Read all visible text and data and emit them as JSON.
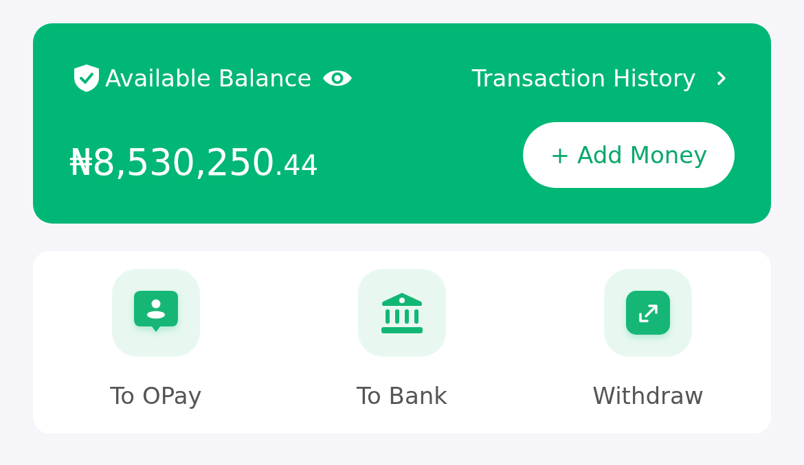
{
  "balance_card": {
    "title": "Available Balance",
    "history_link": "Transaction History",
    "amount": "₦8,530,250",
    "amount_fraction": ".44",
    "add_button": "+ Add Money"
  },
  "actions": [
    {
      "kind": "contact",
      "label": "To OPay"
    },
    {
      "kind": "bank",
      "label": "To Bank"
    },
    {
      "kind": "withdraw",
      "label": "Withdraw"
    }
  ]
}
